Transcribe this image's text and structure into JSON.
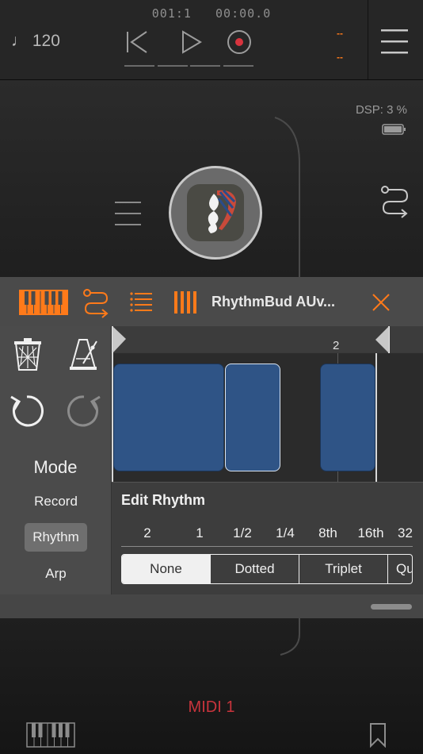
{
  "transport": {
    "position": "001:1",
    "time": "00:00.0",
    "tempo": "♩ 120",
    "meter_top": "--",
    "meter_bottom": "--"
  },
  "graph": {
    "dsp_label": "DSP:",
    "dsp_value": "3 %"
  },
  "plugin": {
    "title": "RhythmBud AUv...",
    "ruler_marker": "2",
    "mode": {
      "title": "Mode",
      "items": [
        "Record",
        "Rhythm",
        "Arp"
      ],
      "selected": "Rhythm"
    },
    "edit_rhythm": {
      "title": "Edit Rhythm",
      "values": [
        "2",
        "1",
        "1/2",
        "1/4",
        "8th",
        "16th",
        "32"
      ],
      "options": [
        "None",
        "Dotted",
        "Triplet",
        "Qu"
      ],
      "selected": "None"
    },
    "note_color": "#2f5486",
    "accent_color": "#ff7a1a"
  },
  "bottom": {
    "track_name": "MIDI 1"
  }
}
